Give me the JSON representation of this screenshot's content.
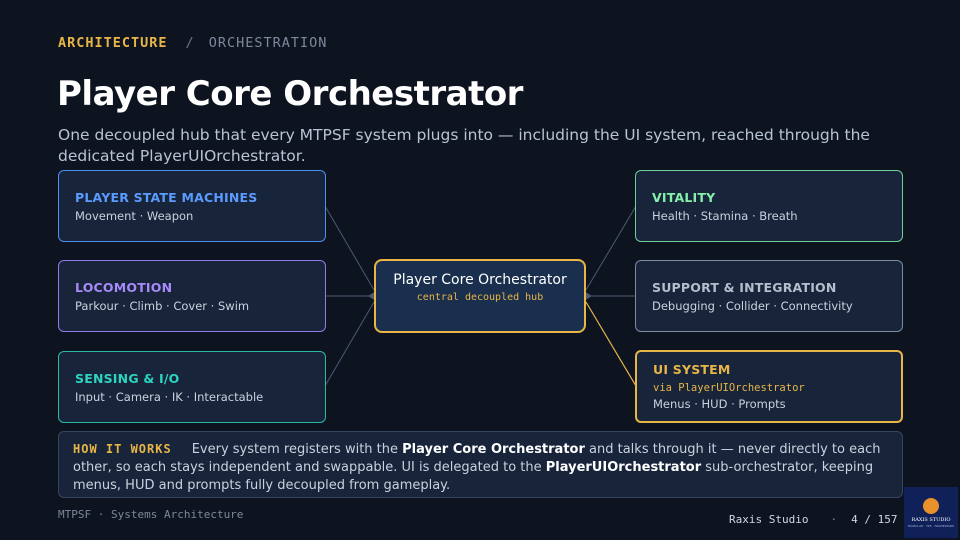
{
  "breadcrumb": {
    "section": "ARCHITECTURE",
    "separator": "/",
    "page": "ORCHESTRATION"
  },
  "title": "Player Core Orchestrator",
  "subtitle": "One decoupled hub that every MTPSF system plugs into — including the UI system, reached through the dedicated PlayerUIOrchestrator.",
  "colors": {
    "accent": "#e8b547",
    "blue": "#4c8df6",
    "purple": "#a78bfa",
    "teal": "#2dd4bf",
    "green": "#86efac",
    "slate": "#9aa7b8"
  },
  "left_cards": [
    {
      "title": "PLAYER STATE MACHINES",
      "items": "Movement · Weapon"
    },
    {
      "title": "LOCOMOTION",
      "items": "Parkour · Climb · Cover · Swim"
    },
    {
      "title": "SENSING & I/O",
      "items": "Input · Camera · IK · Interactable"
    }
  ],
  "right_cards": [
    {
      "title": "VITALITY",
      "items": "Health · Stamina · Breath"
    },
    {
      "title": "SUPPORT & INTEGRATION",
      "items": "Debugging · Collider · Connectivity"
    },
    {
      "title": "UI SYSTEM",
      "via": "via PlayerUIOrchestrator",
      "items": "Menus · HUD · Prompts"
    }
  ],
  "hub": {
    "title": "Player Core Orchestrator",
    "subtitle": "central decoupled hub"
  },
  "how_it_works": {
    "label": "HOW IT WORKS",
    "t1": "Every system registers with the ",
    "b1": "Player Core Orchestrator",
    "t2": " and talks through it — never directly to each other, so each stays independent and swappable. UI is delegated to the ",
    "b2": "PlayerUIOrchestrator",
    "t3": " sub-orchestrator, keeping menus, HUD and prompts fully decoupled from gameplay."
  },
  "footer": {
    "left": "MTPSF · Systems Architecture",
    "studio": "Raxis Studio",
    "dot": "·",
    "page": "4 / 157"
  },
  "logo": {
    "name": "RAXIS STUDIO",
    "tagline": "MODULAR · TPS · FRAMEWORK"
  }
}
